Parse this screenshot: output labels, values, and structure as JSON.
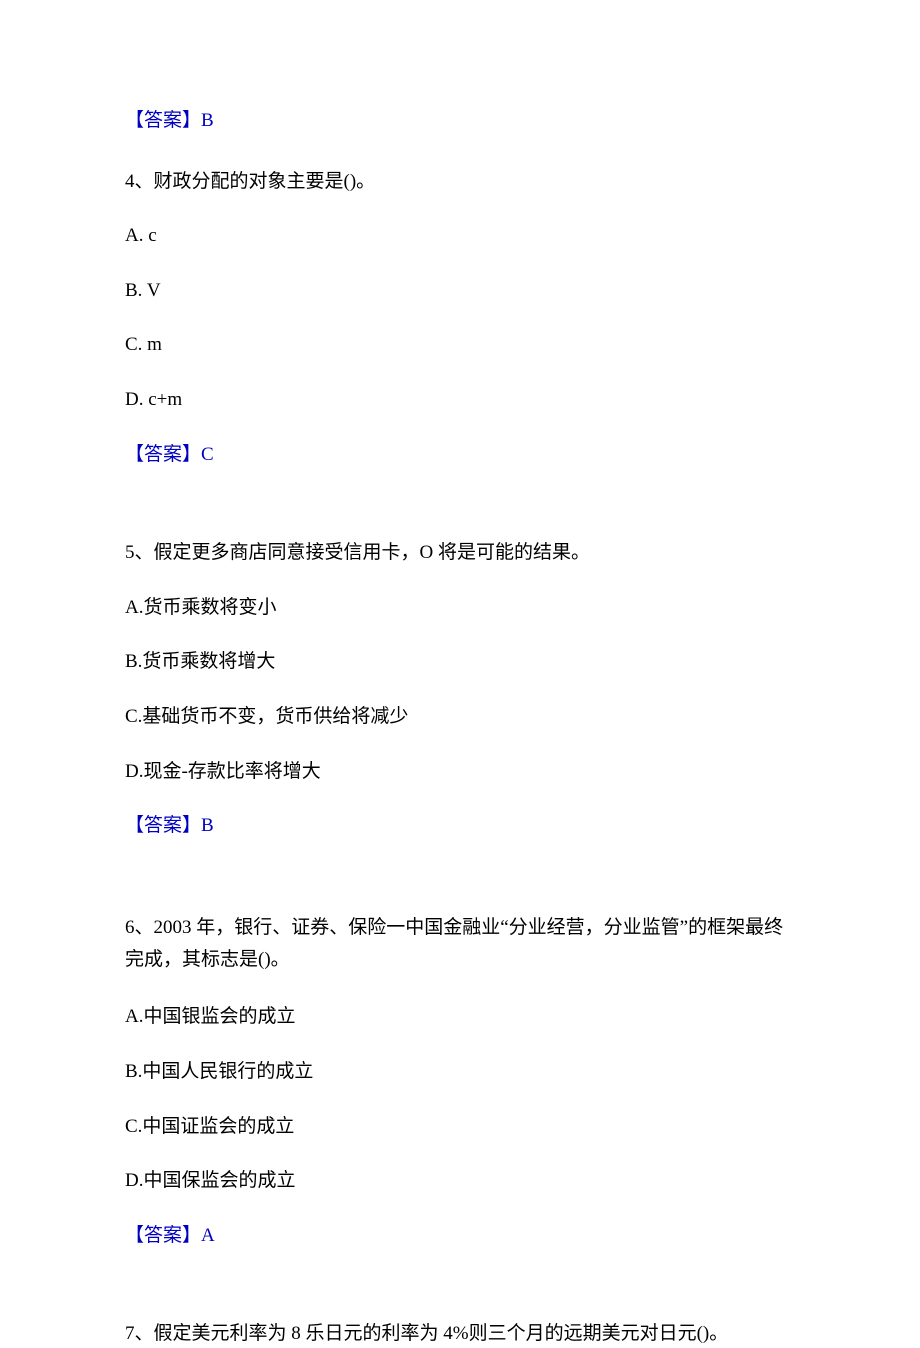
{
  "answers": {
    "ans3": "【答案】B",
    "ans4": "【答案】C",
    "ans5": "【答案】B",
    "ans6": "【答案】A"
  },
  "q4": {
    "stem": "4、财政分配的对象主要是()。",
    "a": "A.  c",
    "b": "B.  V",
    "c": "C.  m",
    "d": "D.  c+m"
  },
  "q5": {
    "stem": "5、假定更多商店同意接受信用卡，O 将是可能的结果。",
    "a": "A.货币乘数将变小",
    "b": "B.货币乘数将增大",
    "c": "C.基础货币不变，货币供给将减少",
    "d": "D.现金-存款比率将增大"
  },
  "q6": {
    "stem": "6、2003 年，银行、证券、保险一中国金融业“分业经营，分业监管”的框架最终完成，其标志是()。",
    "a": "A.中国银监会的成立",
    "b": "B.中国人民银行的成立",
    "c": "C.中国证监会的成立",
    "d": "D.中国保监会的成立"
  },
  "q7": {
    "stem": "7、假定美元利率为 8 乐日元的利率为 4%则三个月的远期美元对日元()。"
  }
}
